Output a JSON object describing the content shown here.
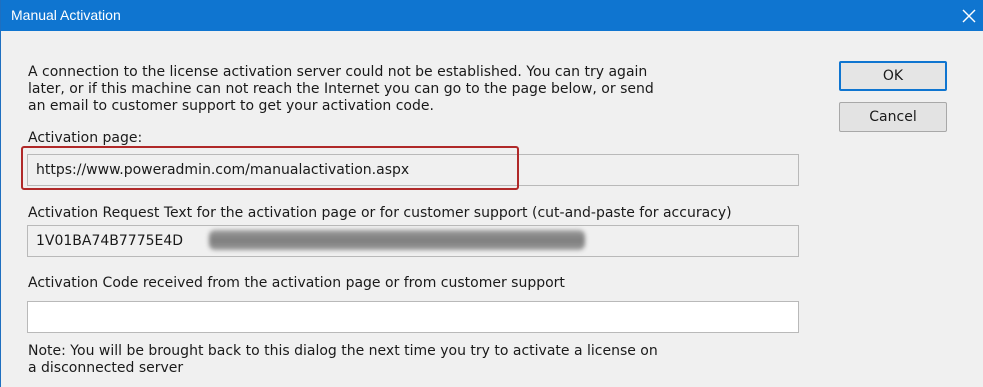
{
  "window": {
    "title": "Manual Activation",
    "close_icon": "close-icon"
  },
  "intro_lines": [
    "A connection to the license activation server could not be established.  You can try again",
    "later, or if this machine can not reach the Internet you can go to the page below, or send",
    "an email to customer support to get your activation code."
  ],
  "activation_page": {
    "label": "Activation page:",
    "value": "https://www.poweradmin.com/manualactivation.aspx"
  },
  "request_text": {
    "label": "Activation Request Text for the activation page or for customer support (cut-and-paste for accuracy)",
    "value": "1V01BA74B7775E4D"
  },
  "activation_code": {
    "label": "Activation Code received from the activation page or from customer support",
    "value": ""
  },
  "note_lines": [
    "Note: You will be brought back to this dialog the next time you try to activate a license on",
    "a disconnected server"
  ],
  "buttons": {
    "ok": "OK",
    "cancel": "Cancel"
  },
  "colors": {
    "titlebar": "#0f75d0",
    "highlight": "#b02929"
  }
}
